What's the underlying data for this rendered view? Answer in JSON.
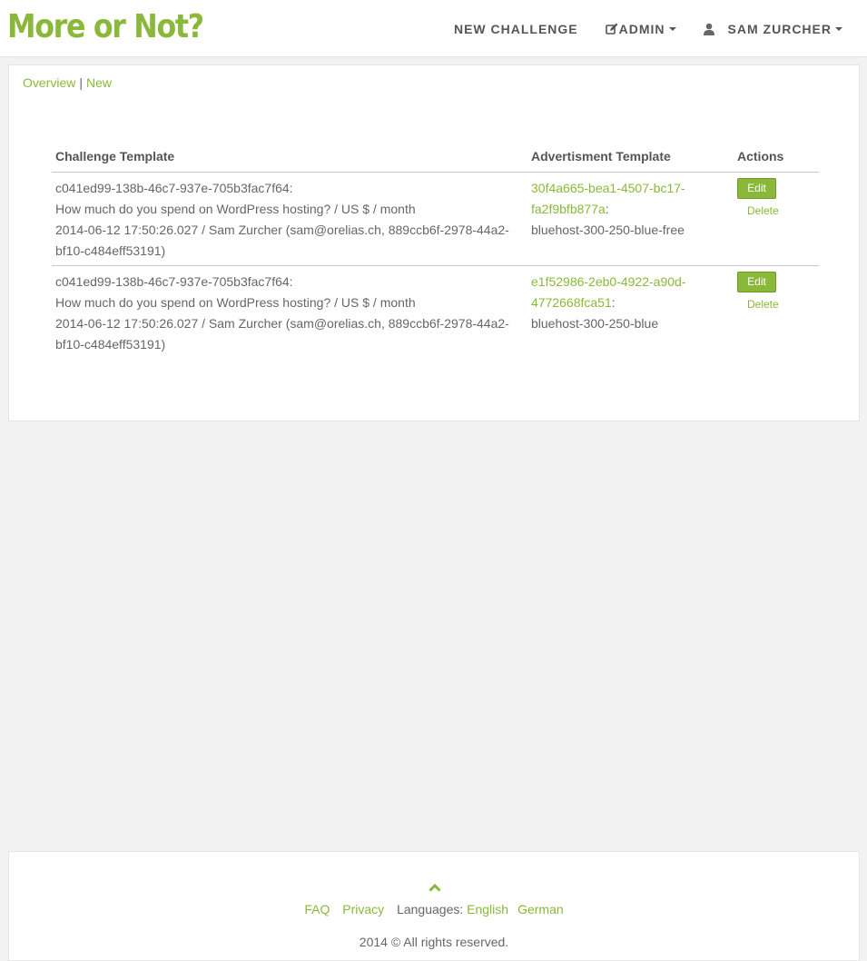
{
  "brand": {
    "name": "More or Not?",
    "color": "#8ab83a"
  },
  "nav": {
    "new_challenge": "NEW CHALLENGE",
    "admin": "ADMIN",
    "user": "SAM ZURCHER"
  },
  "breadcrumb": {
    "overview": "Overview",
    "separator": "|",
    "new": "New"
  },
  "table": {
    "headers": {
      "challenge": "Challenge Template",
      "advert": "Advertisment Template",
      "actions": "Actions"
    },
    "rows": [
      {
        "ch_id": "c041ed99-138b-46c7-937e-705b3fac7f64:",
        "ch_question": "How much do you spend on WordPress hosting? / US $ / month",
        "ch_meta": "2014-06-12 17:50:26.027 / Sam Zurcher (sam@orelias.ch, 889ccb6f-2978-44a2-bf10-c484eff53191)",
        "ad_id": "30f4a665-bea1-4507-bc17-fa2f9bfb877a",
        "ad_colon": ":",
        "ad_name": "bluehost-300-250-blue-free",
        "edit": "Edit",
        "delete": "Delete"
      },
      {
        "ch_id": "c041ed99-138b-46c7-937e-705b3fac7f64:",
        "ch_question": "How much do you spend on WordPress hosting? / US $ / month",
        "ch_meta": "2014-06-12 17:50:26.027 / Sam Zurcher (sam@orelias.ch, 889ccb6f-2978-44a2-bf10-c484eff53191)",
        "ad_id": "e1f52986-2eb0-4922-a90d-4772668fca51",
        "ad_colon": ":",
        "ad_name": "bluehost-300-250-blue",
        "edit": "Edit",
        "delete": "Delete"
      }
    ]
  },
  "footer": {
    "faq": "FAQ",
    "privacy": "Privacy",
    "languages_label": "Languages:",
    "lang_en": "English",
    "lang_de": "German",
    "copyright": "2014 © All rights reserved."
  }
}
